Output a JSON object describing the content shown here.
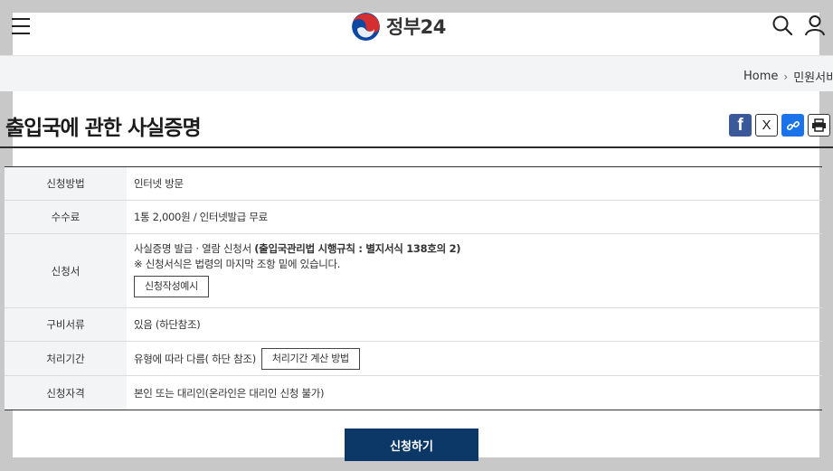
{
  "header": {
    "logo_text": "정부24",
    "menu_icon": "hamburger-menu-icon",
    "search_icon": "search-icon",
    "user_icon": "user-icon"
  },
  "breadcrumb": {
    "home": "Home",
    "current": "민원서비스"
  },
  "page": {
    "title": "출입국에 관한 사실증명"
  },
  "share": {
    "facebook": "f",
    "x": "X",
    "icons": [
      "facebook-icon",
      "x-icon",
      "link-icon",
      "print-icon"
    ]
  },
  "info": {
    "rows": [
      {
        "label": "신청방법",
        "value": "인터넷 방문"
      },
      {
        "label": "수수료",
        "value": "1통 2,000원 / 인터넷발급 무료"
      },
      {
        "label": "신청서",
        "value_prefix": "사실증명 발급 · 열람 신청서 ",
        "value_strong": "(출입국관리법 시행규칙 : 별지서식 138호의 2)",
        "note": "※ 신청서식은 법령의 마지막 조항 밑에 있습니다.",
        "button": "신청작성예시"
      },
      {
        "label": "구비서류",
        "value": "있음 (하단참조)"
      },
      {
        "label": "처리기간",
        "value": "유형에 따라 다름( 하단 참조)",
        "button": "처리기간 계산 방법"
      },
      {
        "label": "신청자격",
        "value": "본인 또는 대리인(온라인은 대리인 신청 불가)"
      }
    ]
  },
  "actions": {
    "apply_label": "신청하기"
  },
  "colors": {
    "primary": "#0b3866",
    "facebook": "#3b5998",
    "link": "#1a73e8",
    "table_header_bg": "#f3f4f6"
  }
}
